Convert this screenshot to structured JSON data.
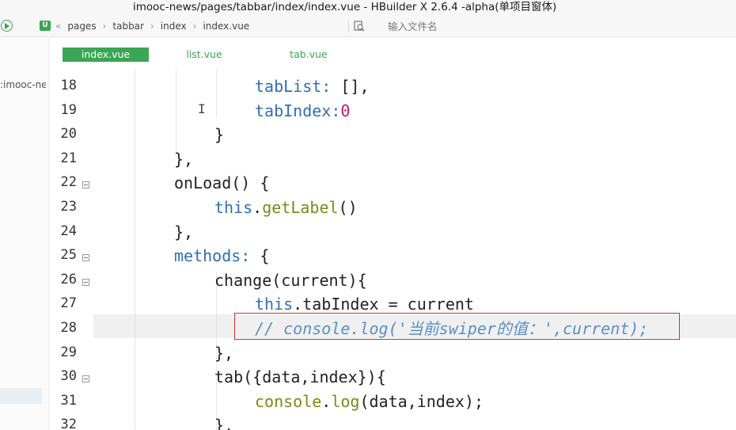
{
  "window": {
    "title": "imooc-news/pages/tabbar/index/index.vue - HBuilder X 2.6.4 -alpha(单项目窗体)"
  },
  "toolbar": {
    "breadcrumb": [
      "pages",
      "tabbar",
      "index",
      "index.vue"
    ],
    "breadcrumb_back": "«",
    "search_placeholder": "输入文件名"
  },
  "sidebar": {
    "project": ":imooc-news"
  },
  "tabs": [
    {
      "label": "index.vue",
      "active": true
    },
    {
      "label": "list.vue",
      "active": false
    },
    {
      "label": "tab.vue",
      "active": false
    }
  ],
  "gutter": {
    "lines": [
      {
        "no": "18",
        "fold": false
      },
      {
        "no": "19",
        "fold": false
      },
      {
        "no": "20",
        "fold": false
      },
      {
        "no": "21",
        "fold": false
      },
      {
        "no": "22",
        "fold": true
      },
      {
        "no": "23",
        "fold": false
      },
      {
        "no": "24",
        "fold": false
      },
      {
        "no": "25",
        "fold": true
      },
      {
        "no": "26",
        "fold": true
      },
      {
        "no": "27",
        "fold": false
      },
      {
        "no": "28",
        "fold": false
      },
      {
        "no": "29",
        "fold": false
      },
      {
        "no": "30",
        "fold": true
      },
      {
        "no": "31",
        "fold": false
      },
      {
        "no": "32",
        "fold": false
      }
    ]
  },
  "code": [
    {
      "indent": 4,
      "tokens": [
        [
          "prop",
          "tabList"
        ],
        [
          "kw",
          ":"
        ],
        [
          "",
          " [],"
        ]
      ]
    },
    {
      "indent": 4,
      "tokens": [
        [
          "prop",
          "tabIndex"
        ],
        [
          "kw",
          ":"
        ],
        [
          "num",
          "0"
        ]
      ]
    },
    {
      "indent": 3,
      "tokens": [
        [
          "",
          "}"
        ]
      ]
    },
    {
      "indent": 2,
      "tokens": [
        [
          "",
          "},"
        ]
      ]
    },
    {
      "indent": 2,
      "tokens": [
        [
          "",
          "onLoad() {"
        ]
      ]
    },
    {
      "indent": 3,
      "tokens": [
        [
          "kw",
          "this"
        ],
        [
          "",
          "."
        ],
        [
          "fn",
          "getLabel"
        ],
        [
          "",
          "()"
        ]
      ]
    },
    {
      "indent": 2,
      "tokens": [
        [
          "",
          "},"
        ]
      ]
    },
    {
      "indent": 2,
      "tokens": [
        [
          "prop",
          "methods"
        ],
        [
          "kw",
          ":"
        ],
        [
          "",
          " {"
        ]
      ]
    },
    {
      "indent": 3,
      "tokens": [
        [
          "",
          "change(current){"
        ]
      ]
    },
    {
      "indent": 4,
      "tokens": [
        [
          "kw",
          "this"
        ],
        [
          "",
          "."
        ],
        [
          "",
          "tabIndex = current"
        ]
      ]
    },
    {
      "indent": 4,
      "tokens": [
        [
          "cmt",
          "// console.log('当前swiper的值：',current);"
        ]
      ]
    },
    {
      "indent": 3,
      "tokens": [
        [
          "",
          "},"
        ]
      ]
    },
    {
      "indent": 3,
      "tokens": [
        [
          "",
          "tab({data,index}){"
        ]
      ]
    },
    {
      "indent": 4,
      "tokens": [
        [
          "fn",
          "console"
        ],
        [
          "",
          "."
        ],
        [
          "fn",
          "log"
        ],
        [
          "",
          "(data,index);"
        ]
      ]
    },
    {
      "indent": 3,
      "tokens": [
        [
          "",
          "},"
        ]
      ]
    }
  ],
  "colors": {
    "accent": "#3aa655",
    "highlight_border": "#d92c2c",
    "keyword": "#2e6fb5"
  }
}
